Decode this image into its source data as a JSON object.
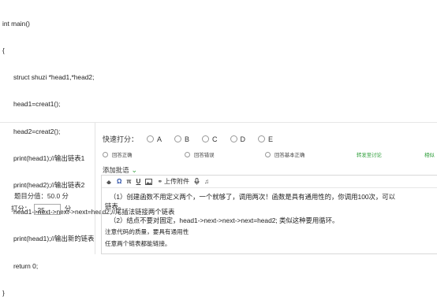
{
  "code": {
    "lines": [
      "int main()",
      "{",
      "      struct shuzi *head1,*head2;",
      "      head1=creat1();",
      "      head2=creat2();",
      "      print(head1);//输出链表1",
      "      print(head2);//输出链表2",
      "      head1->next->next->next=head2;//尾插法链接两个链表",
      "      print(head1);//输出新的链表",
      "      return 0;",
      "}"
    ]
  },
  "score": {
    "label": "题目分值：50.0 分",
    "prefix": "打分：",
    "value": "25",
    "suffix": "分"
  },
  "quick_score": {
    "label": "快速打分：",
    "options": [
      "A",
      "B",
      "C",
      "D",
      "E"
    ]
  },
  "tick_options": [
    "回答正确",
    "回答错误",
    "回答基本正确"
  ],
  "links": {
    "discuss": "转发至讨论",
    "related": "相似"
  },
  "comment": {
    "add_label": "添加批语",
    "toolbar_upload": "上传附件"
  },
  "editor_content": {
    "p1": "（1）创建函数不用定义两个，一个就够了，调用两次！函数是具有通用性的，你调用100次，可以",
    "p1_cont": "链表。",
    "p2": "（2）结点不要对固定，head1->next->next->next=head2; 类似这种要用循环。",
    "p3": "注意代码的质量，要具有通用性",
    "p4": "任意两个链表都能链接。"
  },
  "colors": {
    "accent_green": "#2e9e3a"
  }
}
